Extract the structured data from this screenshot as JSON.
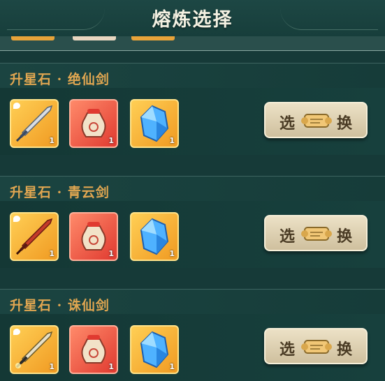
{
  "header": {
    "title": "熔炼选择"
  },
  "rows": [
    {
      "label": "升星石 · 绝仙剑",
      "items": [
        {
          "icon": "sword-icon",
          "count": "1"
        },
        {
          "icon": "pouch-icon",
          "count": "1"
        },
        {
          "icon": "crystal-icon",
          "count": "1"
        }
      ],
      "button": {
        "left": "选",
        "right": "换"
      }
    },
    {
      "label": "升星石 · 青云剑",
      "items": [
        {
          "icon": "sword-icon",
          "count": "1"
        },
        {
          "icon": "pouch-icon",
          "count": "1"
        },
        {
          "icon": "crystal-icon",
          "count": "1"
        }
      ],
      "button": {
        "left": "选",
        "right": "换"
      }
    },
    {
      "label": "升星石 · 诛仙剑",
      "items": [
        {
          "icon": "sword-icon",
          "count": "1"
        },
        {
          "icon": "pouch-icon",
          "count": "1"
        },
        {
          "icon": "crystal-icon",
          "count": "1"
        }
      ],
      "button": {
        "left": "选",
        "right": "换"
      }
    }
  ]
}
